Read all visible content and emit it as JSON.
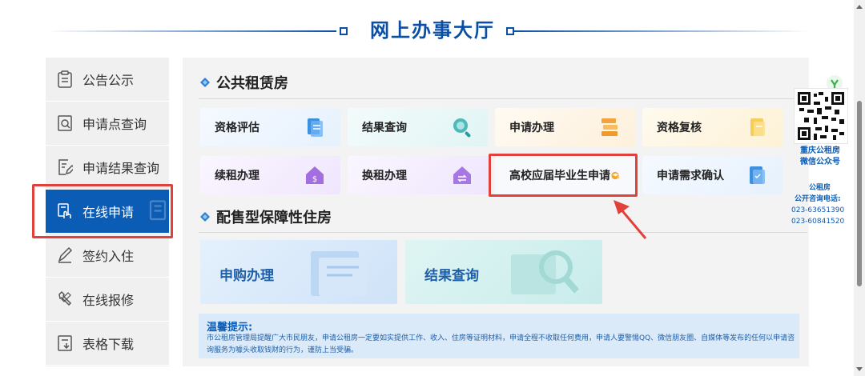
{
  "header": {
    "title": "网上办事大厅"
  },
  "sidebar": {
    "items": [
      {
        "label": "公告公示",
        "icon": "clipboard-icon"
      },
      {
        "label": "申请点查询",
        "icon": "search-doc-icon"
      },
      {
        "label": "申请结果查询",
        "icon": "edit-doc-icon"
      },
      {
        "label": "在线申请",
        "icon": "hand-doc-icon",
        "active": true
      },
      {
        "label": "签约入住",
        "icon": "pen-icon"
      },
      {
        "label": "在线报修",
        "icon": "wrench-icon"
      },
      {
        "label": "表格下载",
        "icon": "download-doc-icon"
      }
    ]
  },
  "public_rental": {
    "title": "公共租赁房",
    "cards": [
      {
        "label": "资格评估"
      },
      {
        "label": "结果查询"
      },
      {
        "label": "申请办理"
      },
      {
        "label": "资格复核"
      },
      {
        "label": "续租办理"
      },
      {
        "label": "换租办理"
      },
      {
        "label": "高校应届毕业生申请"
      },
      {
        "label": "申请需求确认"
      }
    ]
  },
  "affordable_housing": {
    "title": "配售型保障性住房",
    "cards": [
      {
        "label": "申购办理"
      },
      {
        "label": "结果查询"
      }
    ]
  },
  "notice": {
    "title": "温馨提示:",
    "body": "市公租房管理局提醒广大市民朋友，申请公租房一定要如实提供工作、收入、住房等证明材料，申请全程不收取任何费用，申请人要警惕QQ、微信朋友圈、自媒体等发布的任何以申请咨询服务为噱头收取钱财的行为，谨防上当受骗。"
  },
  "qr": {
    "caption_line1": "重庆公租房",
    "caption_line2": "微信公众号"
  },
  "hotline": {
    "label_line1": "公租房",
    "label_line2": "公开咨询电话:",
    "phones": [
      "023-63651390",
      "023-60841520"
    ]
  },
  "colors": {
    "primary": "#0b5cb5",
    "highlight": "#e0413a",
    "title": "#0a4fa4"
  }
}
